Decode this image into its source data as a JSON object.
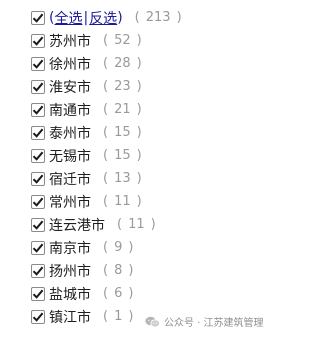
{
  "header": {
    "open_paren": "(",
    "select_all": "全选",
    "separator": "|",
    "invert_select": "反选",
    "close_paren": ")",
    "total": "213"
  },
  "cities": [
    {
      "name": "苏州市",
      "count": "52"
    },
    {
      "name": "徐州市",
      "count": "28"
    },
    {
      "name": "淮安市",
      "count": "23"
    },
    {
      "name": "南通市",
      "count": "21"
    },
    {
      "name": "泰州市",
      "count": "15"
    },
    {
      "name": "无锡市",
      "count": "15"
    },
    {
      "name": "宿迁市",
      "count": "13"
    },
    {
      "name": "常州市",
      "count": "11"
    },
    {
      "name": "连云港市",
      "count": "11"
    },
    {
      "name": "南京市",
      "count": "9"
    },
    {
      "name": "扬州市",
      "count": "8"
    },
    {
      "name": "盐城市",
      "count": "6"
    },
    {
      "name": "镇江市",
      "count": "1"
    }
  ],
  "count_open": "(",
  "count_close": ")",
  "watermark": {
    "text": "公众号 · 江苏建筑管理",
    "icon": "wechat-icon"
  },
  "colors": {
    "link": "#1a1a9a",
    "check": "#1a1a1a",
    "count": "#9a9a9a"
  }
}
